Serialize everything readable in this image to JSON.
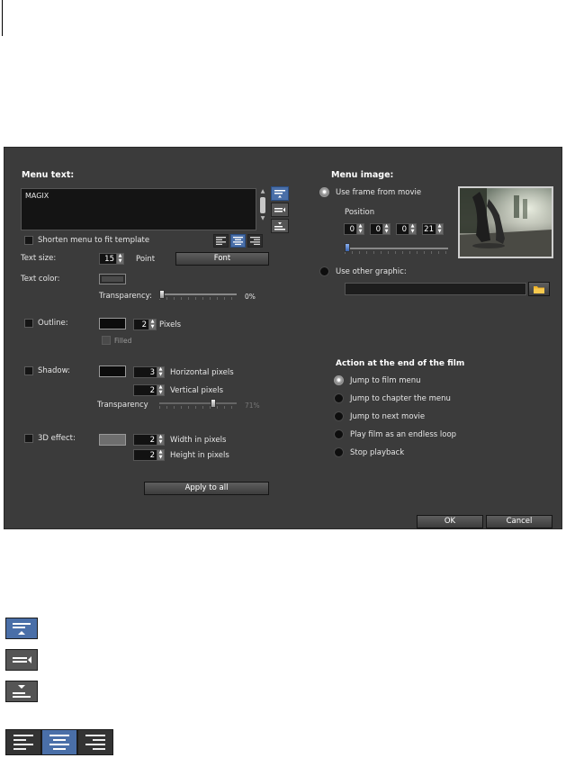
{
  "left": {
    "menu_text_header": "Menu text:",
    "menu_text_value": "MAGIX",
    "shorten_label": "Shorten menu to fit template",
    "text_size_label": "Text size:",
    "text_size_value": "15",
    "text_size_unit": "Point",
    "font_button": "Font",
    "text_color_label": "Text color:",
    "transparency_label": "Transparency:",
    "transparency_value": "0%",
    "outline_label": "Outline:",
    "outline_pixels_value": "2",
    "outline_pixels_unit": "Pixels",
    "filled_label": "Filled",
    "shadow_label": "Shadow:",
    "shadow_h_value": "3",
    "shadow_h_unit": "Horizontal pixels",
    "shadow_v_value": "2",
    "shadow_v_unit": "Vertical pixels",
    "shadow_transparency_label": "Transparency",
    "shadow_transparency_value": "71%",
    "effect3d_label": "3D effect:",
    "effect3d_w_value": "2",
    "effect3d_w_unit": "Width in pixels",
    "effect3d_h_value": "2",
    "effect3d_h_unit": "Height in pixels",
    "apply_button": "Apply to all"
  },
  "right": {
    "menu_image_header": "Menu image:",
    "use_frame_label": "Use frame from movie",
    "position_label": "Position",
    "position_values": [
      "0",
      "0",
      "0",
      "21"
    ],
    "use_other_label": "Use other graphic:",
    "action_header": "Action at the end of the film",
    "actions": [
      "Jump to film menu",
      "Jump to chapter the menu",
      "Jump to next movie",
      "Play film as an endless loop",
      "Stop playback"
    ],
    "ok_button": "OK",
    "cancel_button": "Cancel"
  },
  "values": {
    "transparency_fraction": 0.0,
    "shadow_transparency_fraction": 0.71,
    "position_slider_fraction": 0.0
  },
  "colors": {
    "dialog_bg": "#3b3b3b",
    "accent_blue": "#4a6fa8",
    "folder_icon": "#f0b429"
  },
  "icons": [
    "align-top-icon",
    "align-middle-icon",
    "align-bottom-icon",
    "align-left-icon",
    "align-center-icon",
    "align-right-icon",
    "folder-icon",
    "video-thumbnail"
  ]
}
